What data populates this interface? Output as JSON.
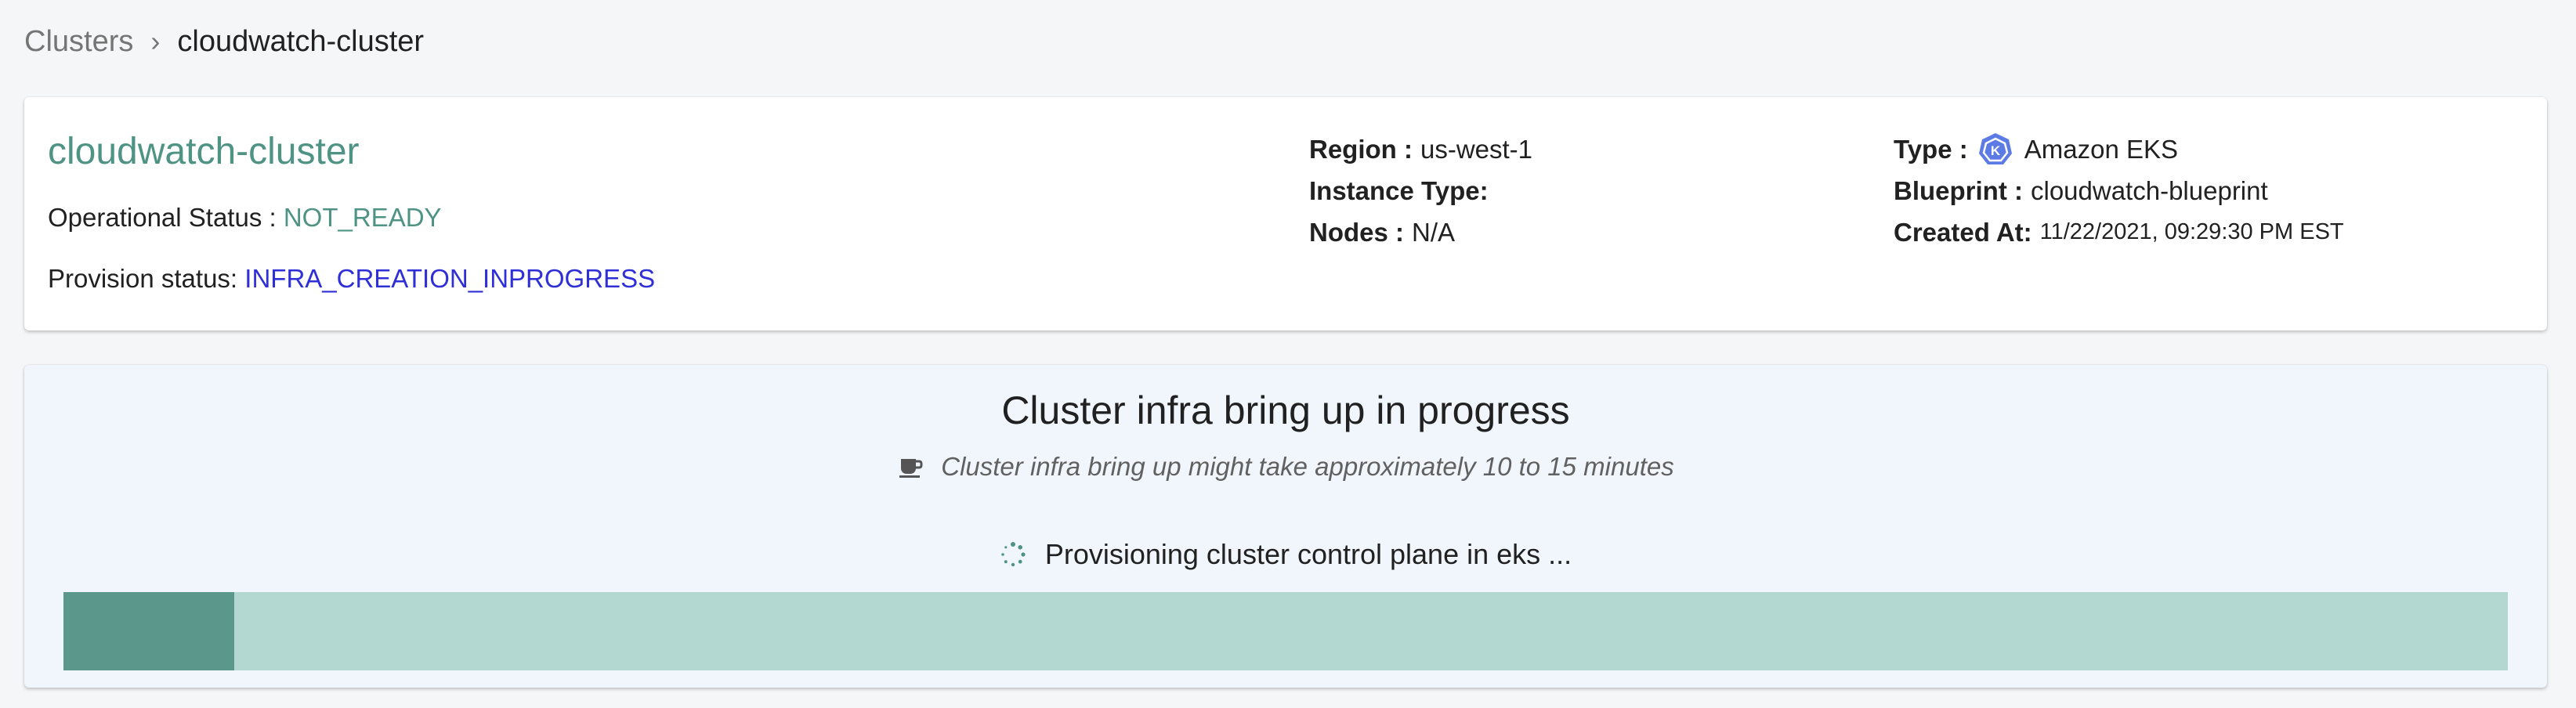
{
  "breadcrumb": {
    "parent": "Clusters",
    "separator": "›",
    "current": "cloudwatch-cluster"
  },
  "cluster": {
    "name": "cloudwatch-cluster",
    "operational_status_label": "Operational Status : ",
    "operational_status_value": "NOT_READY",
    "provision_status_label": "Provision status: ",
    "provision_status_value": "INFRA_CREATION_INPROGRESS",
    "region_label": "Region :",
    "region_value": "us-west-1",
    "instance_type_label": "Instance Type:",
    "instance_type_value": "",
    "nodes_label": "Nodes :",
    "nodes_value": "N/A",
    "type_label": "Type :",
    "type_value": "Amazon EKS",
    "type_icon": "kubernetes-icon",
    "blueprint_label": "Blueprint :",
    "blueprint_value": "cloudwatch-blueprint",
    "created_label": "Created At:",
    "created_value": "11/22/2021, 09:29:30 PM EST"
  },
  "progress": {
    "title": "Cluster infra bring up in progress",
    "subtitle": "Cluster infra bring up might take approximately 10 to 15 minutes",
    "subtitle_icon": "coffee-icon",
    "step_text": "Provisioning cluster control plane in eks ...",
    "step_icon": "spinner-icon",
    "fraction": 0.07
  },
  "colors": {
    "accent_teal": "#4e9383",
    "provision_blue": "#2f2fd8",
    "progress_fill": "#5b978a",
    "progress_track": "#b2d8d1",
    "eks_icon_blue": "#5c7be4"
  }
}
